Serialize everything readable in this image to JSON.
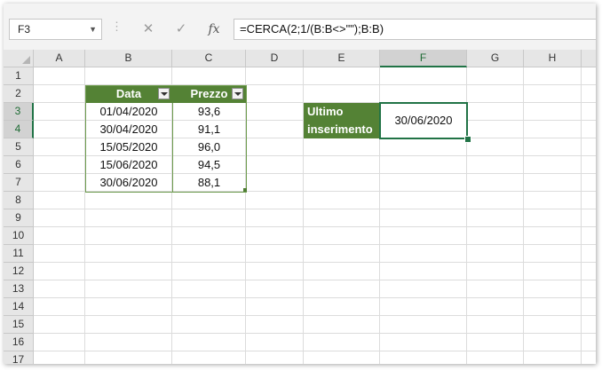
{
  "formula_bar": {
    "name_box": "F3",
    "cancel_icon": "✕",
    "enter_icon": "✓",
    "fx_label": "fx",
    "formula": "=CERCA(2;1/(B:B<>\"\");B:B)"
  },
  "columns": [
    "A",
    "B",
    "C",
    "D",
    "E",
    "F",
    "G",
    "H"
  ],
  "rows": [
    "1",
    "2",
    "3",
    "4",
    "5",
    "6",
    "7",
    "8",
    "9",
    "10",
    "11",
    "12",
    "13",
    "14",
    "15",
    "16",
    "17"
  ],
  "selected_column": "F",
  "selected_rows": [
    "3",
    "4"
  ],
  "table": {
    "headers": [
      "Data",
      "Prezzo"
    ],
    "rows": [
      [
        "01/04/2020",
        "93,6"
      ],
      [
        "30/04/2020",
        "91,1"
      ],
      [
        "15/05/2020",
        "96,0"
      ],
      [
        "15/06/2020",
        "94,5"
      ],
      [
        "30/06/2020",
        "88,1"
      ]
    ]
  },
  "label_cell": {
    "line1": "Ultimo",
    "line2": "inserimento"
  },
  "result_cell": {
    "address": "F3",
    "value": "30/06/2020"
  },
  "colors": {
    "header_fill": "#548235",
    "selection": "#217346"
  }
}
